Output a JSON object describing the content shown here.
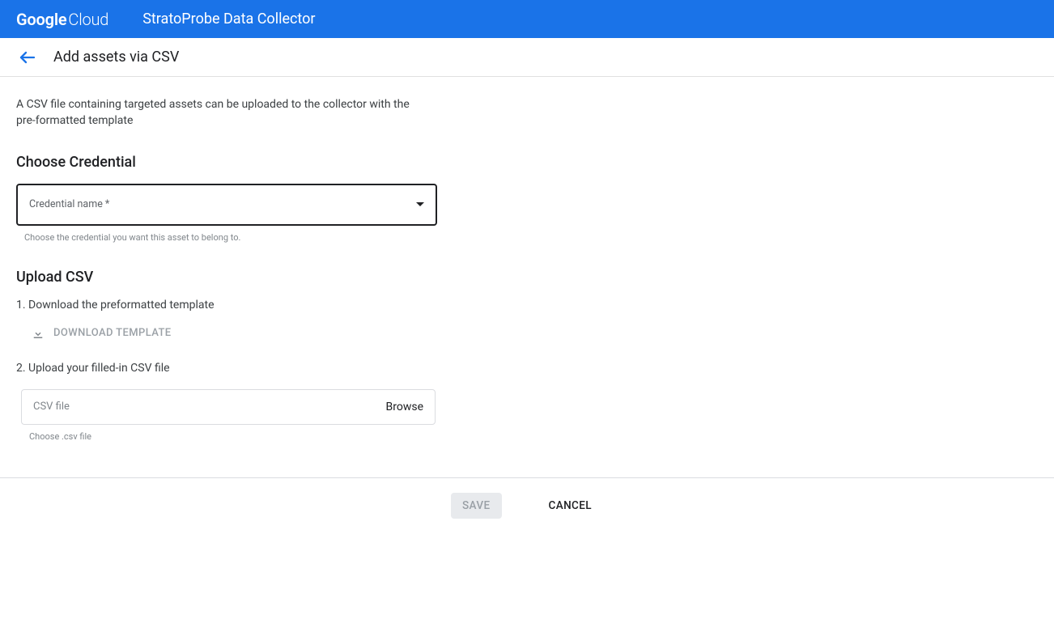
{
  "banner": {
    "logo_bold": "Google",
    "logo_light": "Cloud",
    "app_title": "StratoProbe Data Collector"
  },
  "subheader": {
    "page_title": "Add assets via CSV"
  },
  "intro": "A CSV file containing targeted assets can be uploaded to the collector with the pre-formatted template",
  "credential": {
    "heading": "Choose Credential",
    "field_label": "Credential name *",
    "helper": "Choose the credential you want this asset to belong to."
  },
  "upload": {
    "heading": "Upload CSV",
    "step1": "1. Download the preformatted template",
    "download_label": "DOWNLOAD TEMPLATE",
    "step2": "2. Upload your filled-in CSV file",
    "file_placeholder": "CSV file",
    "browse_label": "Browse",
    "file_helper": "Choose .csv file"
  },
  "footer": {
    "save": "SAVE",
    "cancel": "CANCEL"
  }
}
